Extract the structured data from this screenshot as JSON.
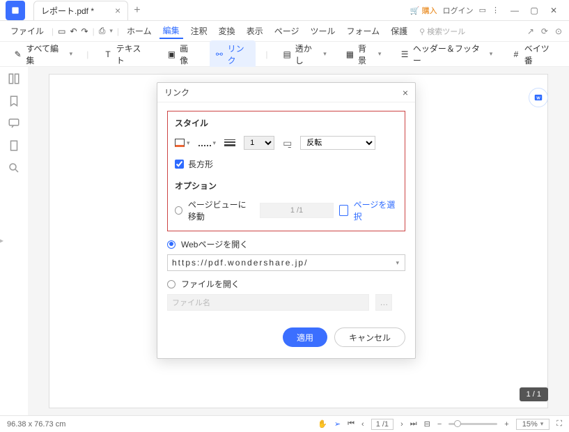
{
  "titlebar": {
    "tab_name": "レポート.pdf *",
    "buy": "購入",
    "login": "ログイン"
  },
  "menubar": {
    "file": "ファイル",
    "items": [
      "ホーム",
      "編集",
      "注釈",
      "変換",
      "表示",
      "ページ",
      "ツール",
      "フォーム",
      "保護"
    ],
    "active_index": 1,
    "search_placeholder": "検索ツール"
  },
  "toolbar": {
    "edit_all": "すべて編集",
    "text": "テキスト",
    "image": "画像",
    "link": "リンク",
    "watermark": "透かし",
    "background": "背景",
    "header_footer": "ヘッダー＆フッター",
    "bates": "ベイツ番"
  },
  "dialog": {
    "title": "リンク",
    "style_label": "スタイル",
    "thickness_value": "1",
    "effect_value": "反転",
    "rectangle_label": "長方形",
    "options_label": "オプション",
    "goto_page_label": "ページビューに移動",
    "page_indicator": "1 /1",
    "select_page": "ページを選択",
    "open_web_label": "Webページを開く",
    "url_value": "https://pdf.wondershare.jp/",
    "open_file_label": "ファイルを開く",
    "file_placeholder": "ファイル名",
    "apply": "適用",
    "cancel": "キャンセル"
  },
  "status": {
    "dimensions": "96.38 x 76.73 cm",
    "page": "1 /1",
    "zoom": "15%"
  },
  "page_badge": "1 / 1"
}
